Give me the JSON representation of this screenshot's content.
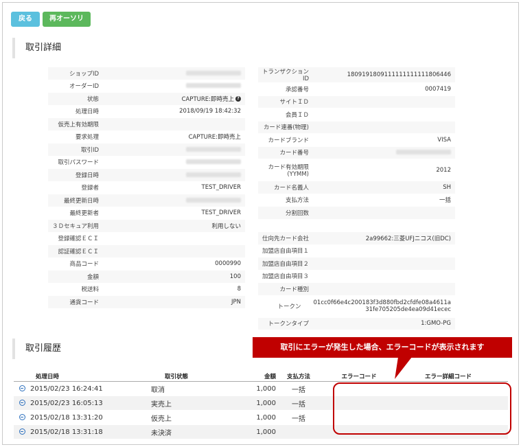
{
  "buttons": {
    "back": "戻る",
    "reorder": "再オーソリ"
  },
  "sections": {
    "detail": "取引詳細",
    "history": "取引履歴"
  },
  "detail_left": [
    {
      "label": "ショップID",
      "value": "",
      "blur": true
    },
    {
      "label": "オーダーID",
      "value": "",
      "blur": true
    },
    {
      "label": "状態",
      "value": "CAPTURE:即時売上",
      "help": true
    },
    {
      "label": "処理日時",
      "value": "2018/09/19 18:42:32"
    },
    {
      "label": "仮売上有効期限",
      "value": ""
    },
    {
      "label": "要求処理",
      "value": "CAPTURE:即時売上"
    },
    {
      "label": "取引ID",
      "value": "",
      "blur": true
    },
    {
      "label": "取引パスワード",
      "value": "",
      "blur": true
    },
    {
      "label": "登録日時",
      "value": "",
      "blur": true
    },
    {
      "label": "登録者",
      "value": "TEST_DRIVER"
    },
    {
      "label": "最終更新日時",
      "value": "",
      "blur": true
    },
    {
      "label": "最終更新者",
      "value": "TEST_DRIVER"
    },
    {
      "label": "３Ｄセキュア利用",
      "value": "利用しない"
    },
    {
      "label": "登録確認ＥＣＩ",
      "value": ""
    },
    {
      "label": "認証確認ＥＣＩ",
      "value": ""
    },
    {
      "label": "商品コード",
      "value": "0000990"
    },
    {
      "label": "金額",
      "value": "100"
    },
    {
      "label": "税送料",
      "value": "8"
    },
    {
      "label": "通貨コード",
      "value": "JPN"
    }
  ],
  "detail_right": [
    {
      "label": "トランザクションID",
      "value": "1809191809111111111111806446"
    },
    {
      "label": "承認番号",
      "value": "0007419"
    },
    {
      "label": "サイトＩＤ",
      "value": ""
    },
    {
      "label": "会員ＩＤ",
      "value": ""
    },
    {
      "label": "カード連番(物理)",
      "value": ""
    },
    {
      "label": "カードブランド",
      "value": "VISA"
    },
    {
      "label": "カード番号",
      "value": "",
      "blur": true
    },
    {
      "label": "カード有効期限\n(YYMM)",
      "value": "2012",
      "tall": true
    },
    {
      "label": "カード名義人",
      "value": "SH"
    },
    {
      "label": "支払方法",
      "value": "一括"
    },
    {
      "label": "分割回数",
      "value": ""
    },
    {
      "gap": true
    },
    {
      "label": "仕向先カード会社",
      "value": "2a99662:三菱UFJニコス(旧DC)"
    },
    {
      "label": "加盟店自由項目１",
      "value": ""
    },
    {
      "label": "加盟店自由項目２",
      "value": ""
    },
    {
      "label": "加盟店自由項目３",
      "value": ""
    },
    {
      "label": "カード種別",
      "value": ""
    },
    {
      "label": "トークン",
      "value": "01cc0f66e4c200183f3d880fbd2cfdfe08a4611a\n31fe705205de4ea09d41ecec",
      "tall": true
    },
    {
      "label": "トークンタイプ",
      "value": "1:GMO-PG"
    }
  ],
  "history": {
    "headers": [
      "処理日時",
      "取引状態",
      "金額",
      "支払方法",
      "エラーコード",
      "エラー詳細コード"
    ],
    "rows": [
      {
        "date": "2015/02/23 16:24:41",
        "status": "取消",
        "amount": "1,000",
        "payment": "一括"
      },
      {
        "date": "2015/02/23 16:05:13",
        "status": "実売上",
        "amount": "1,000",
        "payment": "一括"
      },
      {
        "date": "2015/02/18 13:31:20",
        "status": "仮売上",
        "amount": "1,000",
        "payment": "一括"
      },
      {
        "date": "2015/02/18 13:31:18",
        "status": "未決済",
        "amount": "1,000",
        "payment": ""
      }
    ]
  },
  "callout": "取引にエラーが発生した場合、エラーコードが表示されます",
  "colors": {
    "callout": "#c00000",
    "back_button": "#5bc0de",
    "reorder_button": "#5cb85c"
  }
}
